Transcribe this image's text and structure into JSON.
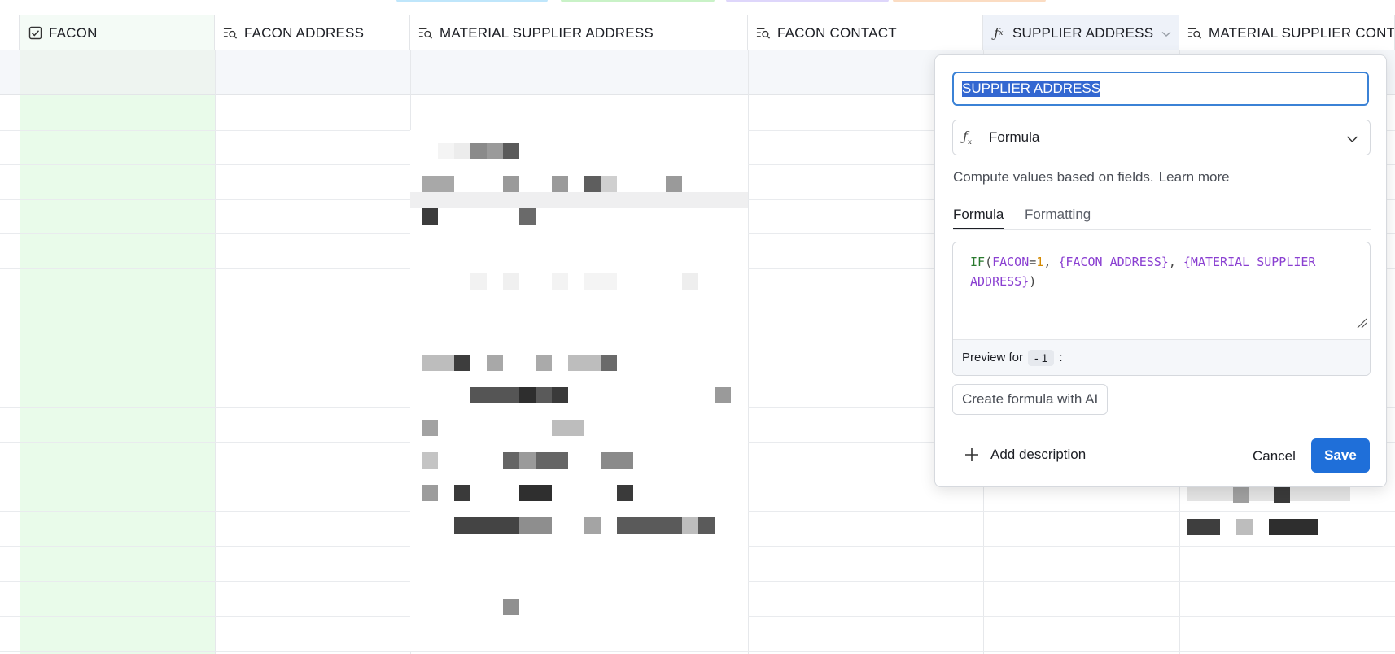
{
  "colors": {
    "accent": "#1f6fd9",
    "facon_column_fill": "#e9fbea",
    "tab_blue": "#bfe6fb",
    "tab_green": "#c9f2c7",
    "tab_purple": "#ded6fb",
    "tab_orange": "#fbdcc2"
  },
  "columns": [
    {
      "label": "FACON",
      "icon": "checkbox-icon"
    },
    {
      "label": "FACON ADDRESS",
      "icon": "lookup-icon"
    },
    {
      "label": "MATERIAL SUPPLIER ADDRESS",
      "icon": "lookup-icon"
    },
    {
      "label": "FACON CONTACT",
      "icon": "lookup-icon"
    },
    {
      "label": "SUPPLIER ADDRESS",
      "icon": "formula-icon"
    },
    {
      "label": "MATERIAL SUPPLIER CONT",
      "icon": "lookup-icon"
    }
  ],
  "popup": {
    "name_value": "SUPPLIER ADDRESS",
    "type_label": "Formula",
    "description": "Compute values based on fields.",
    "learn_more": "Learn more",
    "tabs": [
      "Formula",
      "Formatting"
    ],
    "formula": {
      "fn": "IF",
      "open": "(",
      "field1": "FACON",
      "eq": "=",
      "num": "1",
      "sep1": ", ",
      "field2": "{FACON ADDRESS}",
      "sep2": ", ",
      "field3": "{MATERIAL SUPPLIER ADDRESS}",
      "close": ")"
    },
    "preview_label": "Preview for",
    "preview_chip": "- 1",
    "preview_colon": ":",
    "ai_button": "Create formula with AI",
    "add_description": "Add description",
    "cancel": "Cancel",
    "save": "Save"
  }
}
